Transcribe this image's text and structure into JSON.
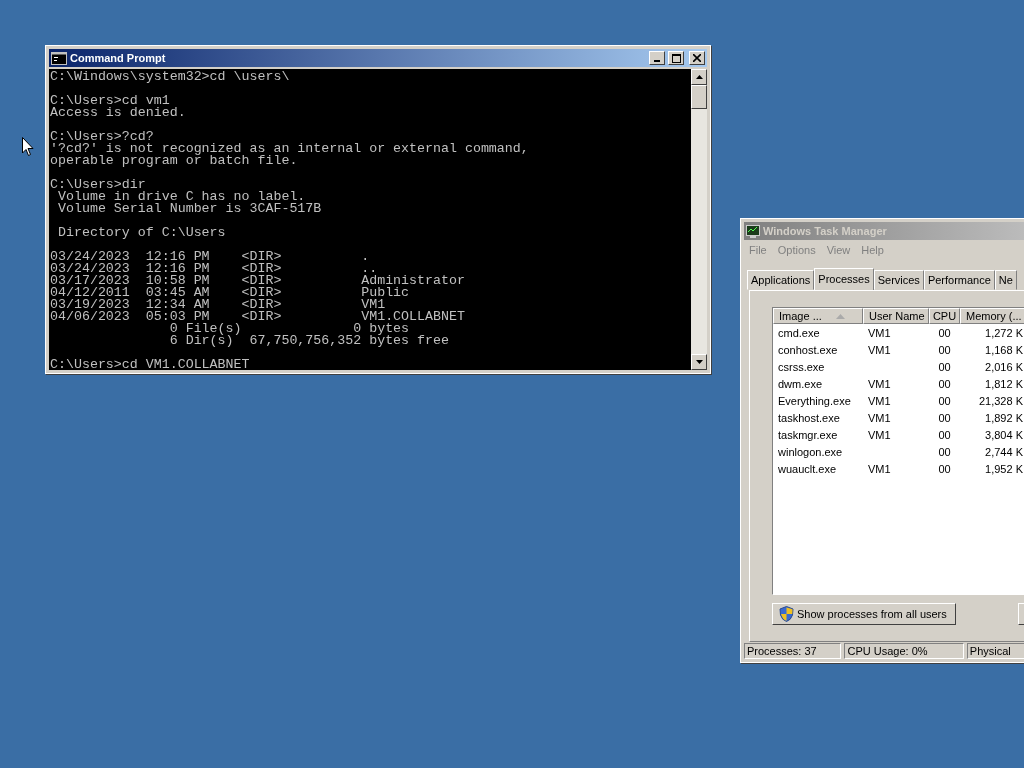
{
  "console_window": {
    "title": "Command Prompt",
    "active": true,
    "blocks": [
      [
        "C:\\Windows\\system32>cd \\users\\"
      ],
      [
        "C:\\Users>cd vm1",
        "Access is denied."
      ],
      [
        "C:\\Users>?cd?",
        "'?cd?' is not recognized as an internal or external command,",
        "operable program or batch file."
      ],
      [
        "C:\\Users>dir",
        " Volume in drive C has no label.",
        " Volume Serial Number is 3CAF-517B"
      ],
      [
        " Directory of C:\\Users"
      ],
      [
        "03/24/2023  12:16 PM    <DIR>          .",
        "03/24/2023  12:16 PM    <DIR>          ..",
        "03/17/2023  10:58 PM    <DIR>          Administrator",
        "04/12/2011  03:45 AM    <DIR>          Public",
        "03/19/2023  12:34 AM    <DIR>          VM1",
        "04/06/2023  05:03 PM    <DIR>          VM1.COLLABNET",
        "               0 File(s)              0 bytes",
        "               6 Dir(s)  67,750,756,352 bytes free"
      ],
      [
        "C:\\Users>cd VM1.COLLABNET"
      ]
    ]
  },
  "task_manager": {
    "title": "Windows Task Manager",
    "active": false,
    "menu": [
      "File",
      "Options",
      "View",
      "Help"
    ],
    "tabs": [
      {
        "label": "Applications",
        "selected": false
      },
      {
        "label": "Processes",
        "selected": true
      },
      {
        "label": "Services",
        "selected": false
      },
      {
        "label": "Performance",
        "selected": false
      },
      {
        "label": "Ne",
        "selected": false
      }
    ],
    "columns": [
      "Image ...",
      "User Name",
      "CPU",
      "Memory (..."
    ],
    "rows": [
      {
        "image": "cmd.exe",
        "user": "VM1",
        "cpu": "00",
        "memory": "1,272 K"
      },
      {
        "image": "conhost.exe",
        "user": "VM1",
        "cpu": "00",
        "memory": "1,168 K"
      },
      {
        "image": "csrss.exe",
        "cpu": "00",
        "memory": "2,016 K"
      },
      {
        "image": "dwm.exe",
        "user": "VM1",
        "cpu": "00",
        "memory": "1,812 K"
      },
      {
        "image": "Everything.exe",
        "user": "VM1",
        "cpu": "00",
        "memory": "21,328 K"
      },
      {
        "image": "taskhost.exe",
        "user": "VM1",
        "cpu": "00",
        "memory": "1,892 K"
      },
      {
        "image": "taskmgr.exe",
        "user": "VM1",
        "cpu": "00",
        "memory": "3,804 K"
      },
      {
        "image": "winlogon.exe",
        "cpu": "00",
        "memory": "2,744 K"
      },
      {
        "image": "wuauclt.exe",
        "user": "VM1",
        "cpu": "00",
        "memory": "1,952 K"
      }
    ],
    "show_all_button": "Show processes from all users",
    "status_bar": [
      "Processes: 37",
      "CPU Usage: 0%",
      "Physical"
    ]
  }
}
